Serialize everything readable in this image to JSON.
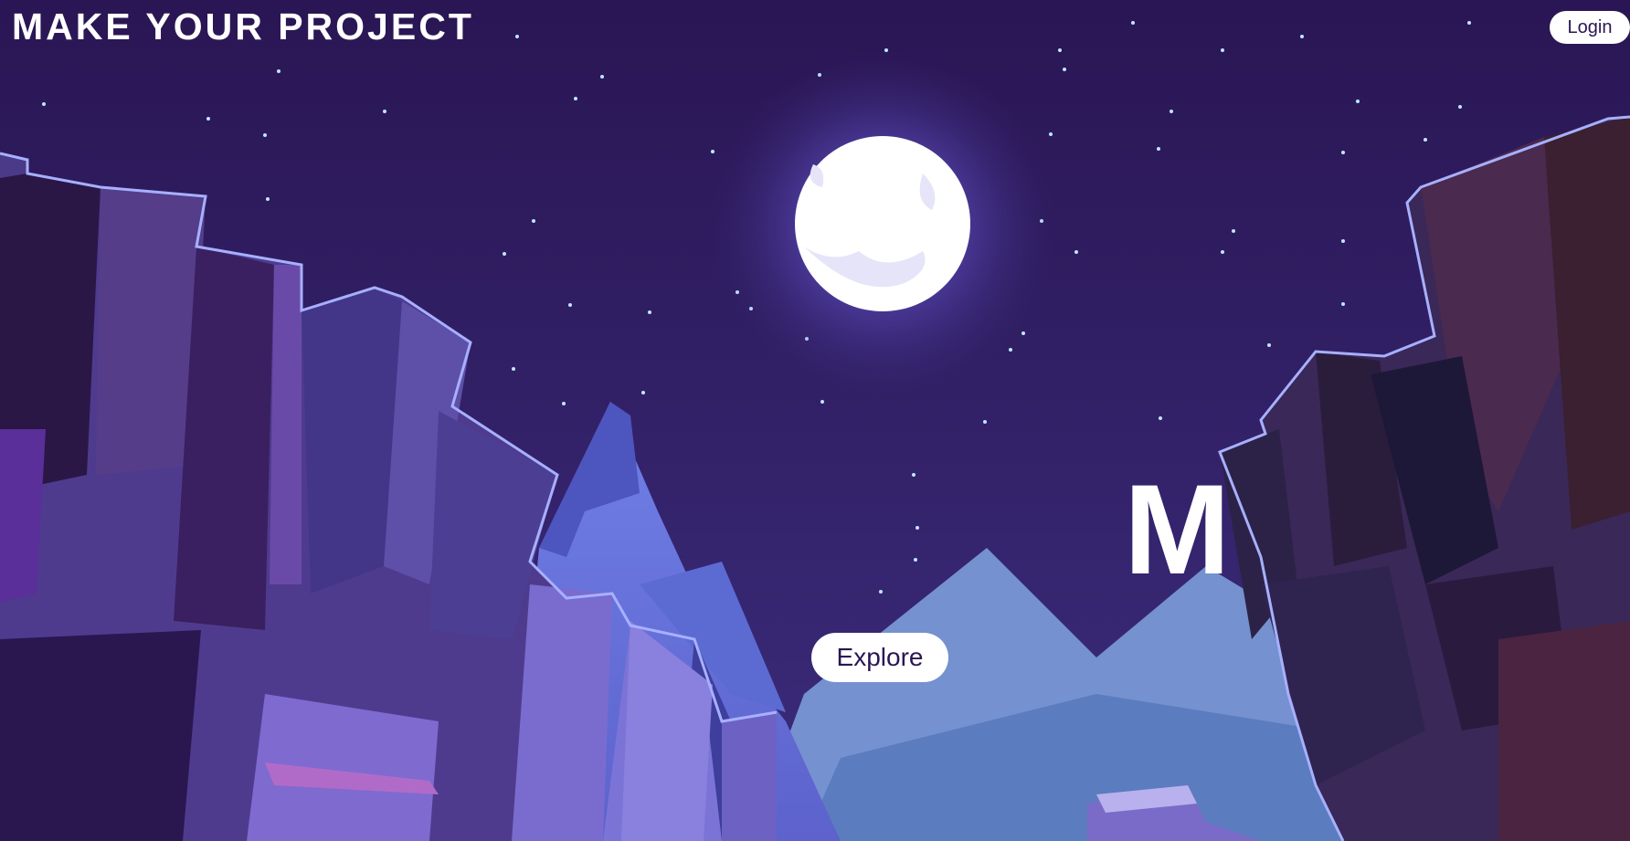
{
  "header": {
    "brand_title": "MAKE YOUR PROJECT",
    "login_label": "Login"
  },
  "hero": {
    "title_visible": "M",
    "explore_label": "Explore"
  },
  "colors": {
    "sky_top": "#2a1654",
    "sky_bottom": "#3a2a7a",
    "moon": "#ffffff",
    "moon_glow": "#8a7cff",
    "button_bg": "#ffffff",
    "button_text": "#2a1654"
  },
  "icons": {
    "scene": "night-mountain-landscape-illustration",
    "moon": "moon-icon"
  }
}
